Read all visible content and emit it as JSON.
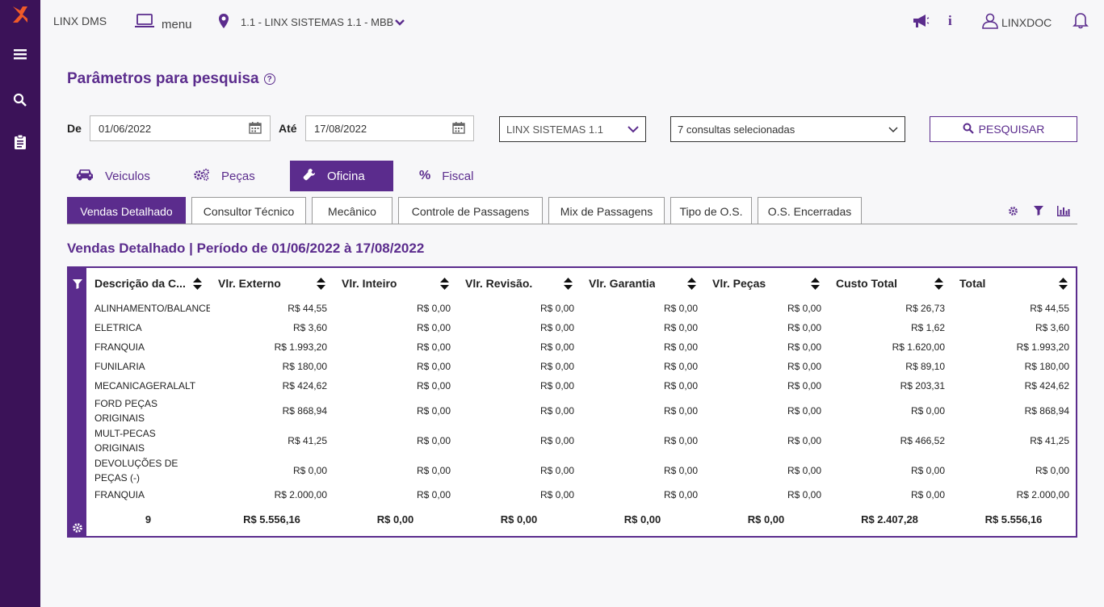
{
  "app": {
    "name": "LINX DMS",
    "menu_label": "menu",
    "company": "1.1 - LINX SISTEMAS 1.1 - MBB",
    "user": "LINXDOC",
    "info_label": "i"
  },
  "search": {
    "title": "Parâmetros para pesquisa",
    "help": "?",
    "from_label": "De",
    "from_value": "01/06/2022",
    "to_label": "Até",
    "to_value": "17/08/2022",
    "company_select": "LINX SISTEMAS 1.1",
    "queries_select": "7 consultas selecionadas",
    "search_button": "PESQUISAR"
  },
  "main_tabs": [
    "Veiculos",
    "Peças",
    "Oficina",
    "Fiscal"
  ],
  "sub_tabs": [
    "Vendas Detalhado",
    "Consultor Técnico",
    "Mecânico",
    "Controle de Passagens",
    "Mix de Passagens",
    "Tipo de O.S.",
    "O.S. Encerradas"
  ],
  "report": {
    "title": "Vendas Detalhado | Período de 01/06/2022 à 17/08/2022",
    "columns": [
      "Descrição da C...",
      "Vlr. Externo",
      "Vlr. Inteiro",
      "Vlr. Revisão.",
      "Vlr. Garantia",
      "Vlr. Peças",
      "Custo Total",
      "Total"
    ],
    "rows": [
      [
        "ALINHAMENTO/BALANCEAMENTO",
        "R$ 44,55",
        "R$ 0,00",
        "R$ 0,00",
        "R$ 0,00",
        "R$ 0,00",
        "R$ 26,73",
        "R$ 44,55"
      ],
      [
        "ELETRICA",
        "R$ 3,60",
        "R$ 0,00",
        "R$ 0,00",
        "R$ 0,00",
        "R$ 0,00",
        "R$ 1,62",
        "R$ 3,60"
      ],
      [
        "FRANQUIA",
        "R$ 1.993,20",
        "R$ 0,00",
        "R$ 0,00",
        "R$ 0,00",
        "R$ 0,00",
        "R$ 1.620,00",
        "R$ 1.993,20"
      ],
      [
        "FUNILARIA",
        "R$ 180,00",
        "R$ 0,00",
        "R$ 0,00",
        "R$ 0,00",
        "R$ 0,00",
        "R$ 89,10",
        "R$ 180,00"
      ],
      [
        "MECANICAGERALALT",
        "R$ 424,62",
        "R$ 0,00",
        "R$ 0,00",
        "R$ 0,00",
        "R$ 0,00",
        "R$ 203,31",
        "R$ 424,62"
      ],
      [
        "FORD PEÇAS ORIGINAIS",
        "R$ 868,94",
        "R$ 0,00",
        "R$ 0,00",
        "R$ 0,00",
        "R$ 0,00",
        "R$ 0,00",
        "R$ 868,94"
      ],
      [
        "MULT-PECAS ORIGINAIS",
        "R$ 41,25",
        "R$ 0,00",
        "R$ 0,00",
        "R$ 0,00",
        "R$ 0,00",
        "R$ 466,52",
        "R$ 41,25"
      ],
      [
        "DEVOLUÇÕES DE PEÇAS (-)",
        "R$ 0,00",
        "R$ 0,00",
        "R$ 0,00",
        "R$ 0,00",
        "R$ 0,00",
        "R$ 0,00",
        "R$ 0,00"
      ],
      [
        "FRANQUIA",
        "R$ 2.000,00",
        "R$ 0,00",
        "R$ 0,00",
        "R$ 0,00",
        "R$ 0,00",
        "R$ 0,00",
        "R$ 2.000,00"
      ]
    ],
    "totals": [
      "9",
      "R$ 5.556,16",
      "R$ 0,00",
      "R$ 0,00",
      "R$ 0,00",
      "R$ 0,00",
      "R$ 2.407,28",
      "R$ 5.556,16"
    ]
  },
  "colors": {
    "brand": "#5b2c8d",
    "sidebar": "#3b1258",
    "logo": "#f05a28"
  }
}
